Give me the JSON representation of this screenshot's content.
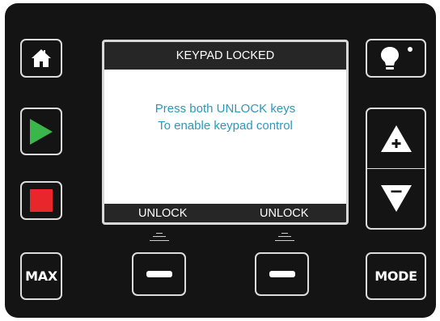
{
  "display": {
    "title": "KEYPAD LOCKED",
    "message_line1": "Press both UNLOCK keys",
    "message_line2": "To enable keypad control",
    "softkey_left_label": "UNLOCK",
    "softkey_right_label": "UNLOCK"
  },
  "buttons": {
    "max_label": "MAX",
    "mode_label": "MODE"
  },
  "icons": {
    "home": "home-icon",
    "play": "play-icon",
    "stop": "stop-icon",
    "light": "lightbulb-icon",
    "plus": "plus-triangle-icon",
    "minus": "minus-triangle-icon",
    "softkey": "softkey-dash-icon"
  },
  "colors": {
    "panel": "#141414",
    "key_border": "#dcdcdc",
    "play": "#3bb64a",
    "stop": "#e8262c",
    "message_text": "#2f97b7",
    "screen_bar": "#262626"
  }
}
